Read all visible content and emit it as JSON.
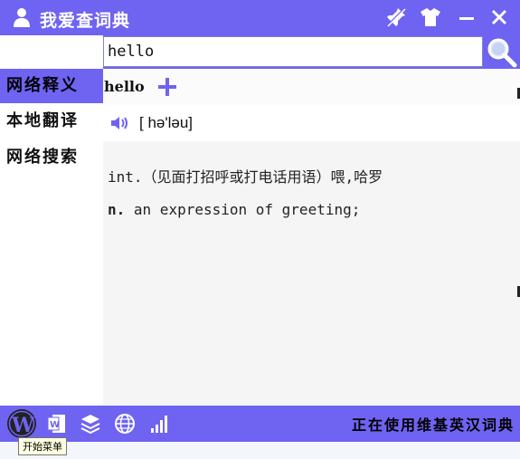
{
  "app": {
    "title": "我爱查词典"
  },
  "search": {
    "value": "hello"
  },
  "sidebar": {
    "items": [
      {
        "label": "网络释义",
        "active": true
      },
      {
        "label": "本地翻译",
        "active": false
      },
      {
        "label": "网络搜索",
        "active": false
      }
    ]
  },
  "entry": {
    "word": "hello",
    "phonetic": "[ hə'ləu]",
    "definitions": [
      {
        "text": "int.（见面打招呼或打电话用语）喂,哈罗"
      },
      {
        "pos": "n.",
        "text": "an expression of greeting;"
      }
    ]
  },
  "statusbar": {
    "text": "正在使用维基英汉词典"
  },
  "tooltip": {
    "text": "开始菜单"
  },
  "colors": {
    "accent": "#6f63f2",
    "content_bg": "#f5f5f5"
  },
  "icons": [
    "user-icon",
    "pin-icon",
    "skin-icon",
    "minimize-icon",
    "close-icon",
    "ie-icon",
    "back-icon",
    "forward-icon",
    "search-icon",
    "add-icon",
    "speaker-icon",
    "wordpress-icon",
    "word-doc-icon",
    "layers-icon",
    "globe-icon",
    "signal-icon"
  ]
}
